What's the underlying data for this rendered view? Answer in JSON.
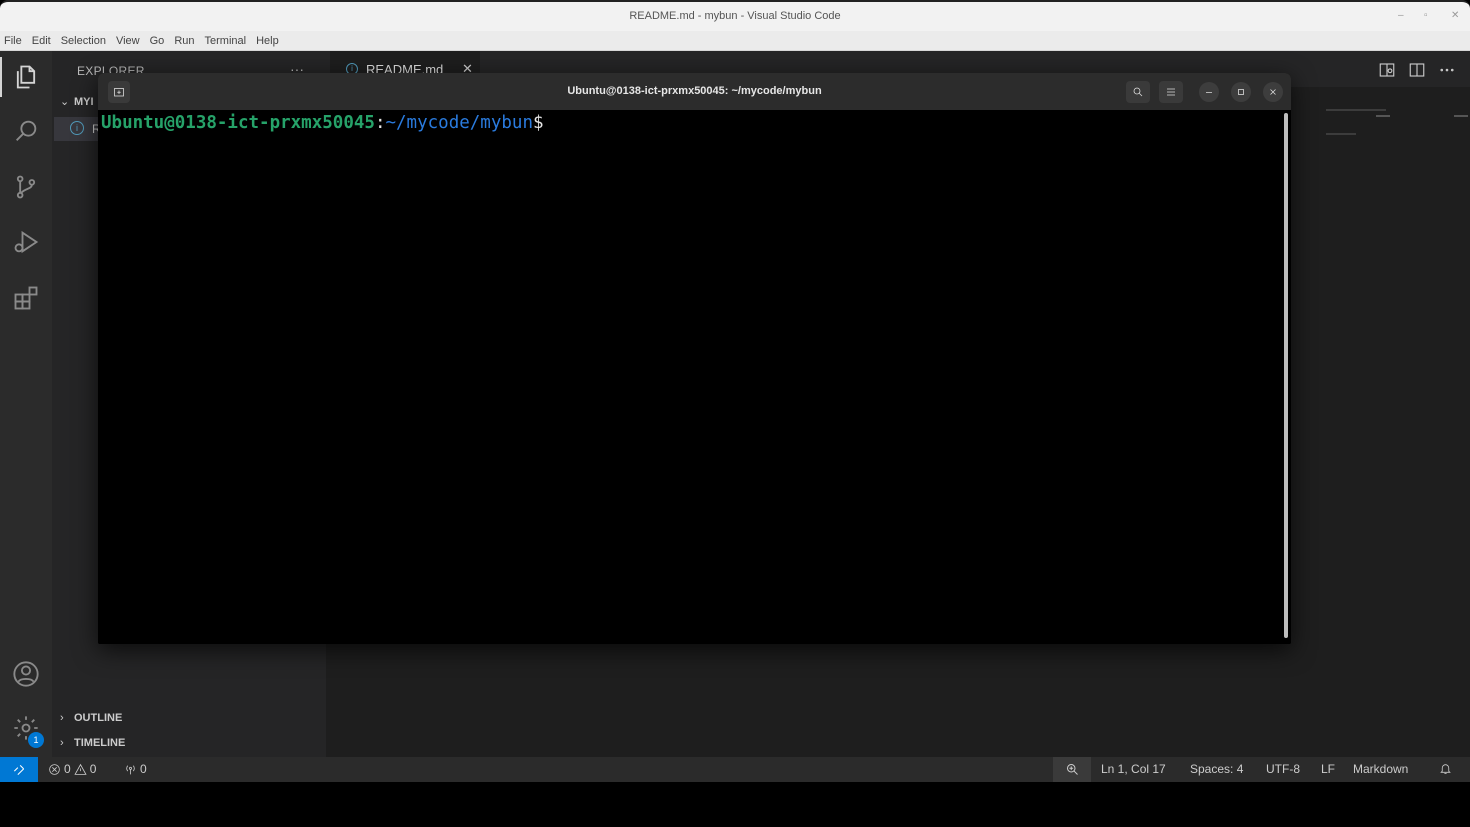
{
  "window": {
    "title": "README.md - mybun - Visual Studio Code",
    "minimize": "–",
    "maximize": "▫",
    "close": "✕"
  },
  "menu": [
    "File",
    "Edit",
    "Selection",
    "View",
    "Go",
    "Run",
    "Terminal",
    "Help"
  ],
  "activity_bar": {
    "icons": [
      "explorer-icon",
      "search-icon",
      "source-control-icon",
      "run-debug-icon",
      "extensions-icon",
      "account-icon",
      "gear-icon"
    ],
    "settings_badge": "1"
  },
  "sidebar": {
    "title": "EXPLORER",
    "more": "···",
    "folder": "MYI",
    "file": "R",
    "sections": [
      "OUTLINE",
      "TIMELINE"
    ]
  },
  "editor": {
    "tab_label": "README.md",
    "tab_close": "✕"
  },
  "terminal": {
    "title": "Ubuntu@0138-ict-prxmx50045: ~/mycode/mybun",
    "prompt_user": "Ubuntu@0138-ict-prxmx50045",
    "prompt_colon": ":",
    "prompt_path": "~/mycode/mybun",
    "prompt_symbol": "$"
  },
  "statusbar": {
    "errors": "0",
    "warnings": "0",
    "ports": "0",
    "position": "Ln 1, Col 17",
    "spaces": "Spaces: 4",
    "encoding": "UTF-8",
    "eol": "LF",
    "language": "Markdown"
  },
  "colors": {
    "accent": "#0078d4",
    "prompt_user": "#26a269",
    "prompt_path": "#2a7bde"
  }
}
